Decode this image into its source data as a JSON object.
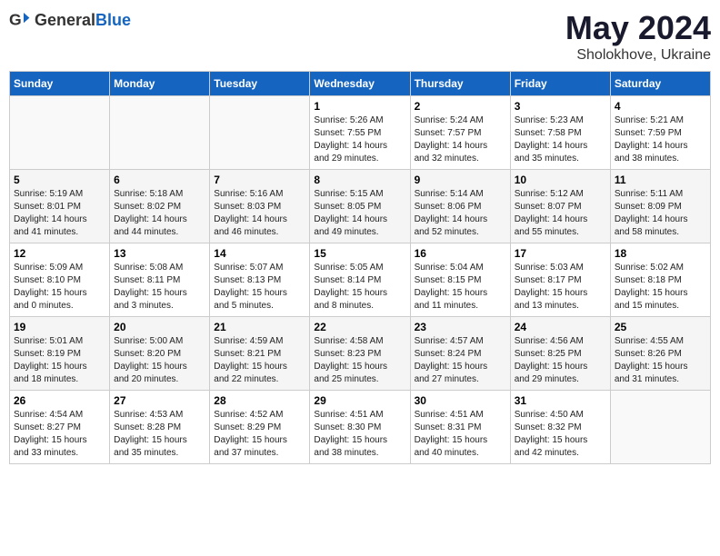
{
  "header": {
    "logo_general": "General",
    "logo_blue": "Blue",
    "month_title": "May 2024",
    "location": "Sholokhove, Ukraine"
  },
  "days_of_week": [
    "Sunday",
    "Monday",
    "Tuesday",
    "Wednesday",
    "Thursday",
    "Friday",
    "Saturday"
  ],
  "weeks": [
    {
      "days": [
        {
          "num": "",
          "text": ""
        },
        {
          "num": "",
          "text": ""
        },
        {
          "num": "",
          "text": ""
        },
        {
          "num": "1",
          "text": "Sunrise: 5:26 AM\nSunset: 7:55 PM\nDaylight: 14 hours\nand 29 minutes."
        },
        {
          "num": "2",
          "text": "Sunrise: 5:24 AM\nSunset: 7:57 PM\nDaylight: 14 hours\nand 32 minutes."
        },
        {
          "num": "3",
          "text": "Sunrise: 5:23 AM\nSunset: 7:58 PM\nDaylight: 14 hours\nand 35 minutes."
        },
        {
          "num": "4",
          "text": "Sunrise: 5:21 AM\nSunset: 7:59 PM\nDaylight: 14 hours\nand 38 minutes."
        }
      ]
    },
    {
      "days": [
        {
          "num": "5",
          "text": "Sunrise: 5:19 AM\nSunset: 8:01 PM\nDaylight: 14 hours\nand 41 minutes."
        },
        {
          "num": "6",
          "text": "Sunrise: 5:18 AM\nSunset: 8:02 PM\nDaylight: 14 hours\nand 44 minutes."
        },
        {
          "num": "7",
          "text": "Sunrise: 5:16 AM\nSunset: 8:03 PM\nDaylight: 14 hours\nand 46 minutes."
        },
        {
          "num": "8",
          "text": "Sunrise: 5:15 AM\nSunset: 8:05 PM\nDaylight: 14 hours\nand 49 minutes."
        },
        {
          "num": "9",
          "text": "Sunrise: 5:14 AM\nSunset: 8:06 PM\nDaylight: 14 hours\nand 52 minutes."
        },
        {
          "num": "10",
          "text": "Sunrise: 5:12 AM\nSunset: 8:07 PM\nDaylight: 14 hours\nand 55 minutes."
        },
        {
          "num": "11",
          "text": "Sunrise: 5:11 AM\nSunset: 8:09 PM\nDaylight: 14 hours\nand 58 minutes."
        }
      ]
    },
    {
      "days": [
        {
          "num": "12",
          "text": "Sunrise: 5:09 AM\nSunset: 8:10 PM\nDaylight: 15 hours\nand 0 minutes."
        },
        {
          "num": "13",
          "text": "Sunrise: 5:08 AM\nSunset: 8:11 PM\nDaylight: 15 hours\nand 3 minutes."
        },
        {
          "num": "14",
          "text": "Sunrise: 5:07 AM\nSunset: 8:13 PM\nDaylight: 15 hours\nand 5 minutes."
        },
        {
          "num": "15",
          "text": "Sunrise: 5:05 AM\nSunset: 8:14 PM\nDaylight: 15 hours\nand 8 minutes."
        },
        {
          "num": "16",
          "text": "Sunrise: 5:04 AM\nSunset: 8:15 PM\nDaylight: 15 hours\nand 11 minutes."
        },
        {
          "num": "17",
          "text": "Sunrise: 5:03 AM\nSunset: 8:17 PM\nDaylight: 15 hours\nand 13 minutes."
        },
        {
          "num": "18",
          "text": "Sunrise: 5:02 AM\nSunset: 8:18 PM\nDaylight: 15 hours\nand 15 minutes."
        }
      ]
    },
    {
      "days": [
        {
          "num": "19",
          "text": "Sunrise: 5:01 AM\nSunset: 8:19 PM\nDaylight: 15 hours\nand 18 minutes."
        },
        {
          "num": "20",
          "text": "Sunrise: 5:00 AM\nSunset: 8:20 PM\nDaylight: 15 hours\nand 20 minutes."
        },
        {
          "num": "21",
          "text": "Sunrise: 4:59 AM\nSunset: 8:21 PM\nDaylight: 15 hours\nand 22 minutes."
        },
        {
          "num": "22",
          "text": "Sunrise: 4:58 AM\nSunset: 8:23 PM\nDaylight: 15 hours\nand 25 minutes."
        },
        {
          "num": "23",
          "text": "Sunrise: 4:57 AM\nSunset: 8:24 PM\nDaylight: 15 hours\nand 27 minutes."
        },
        {
          "num": "24",
          "text": "Sunrise: 4:56 AM\nSunset: 8:25 PM\nDaylight: 15 hours\nand 29 minutes."
        },
        {
          "num": "25",
          "text": "Sunrise: 4:55 AM\nSunset: 8:26 PM\nDaylight: 15 hours\nand 31 minutes."
        }
      ]
    },
    {
      "days": [
        {
          "num": "26",
          "text": "Sunrise: 4:54 AM\nSunset: 8:27 PM\nDaylight: 15 hours\nand 33 minutes."
        },
        {
          "num": "27",
          "text": "Sunrise: 4:53 AM\nSunset: 8:28 PM\nDaylight: 15 hours\nand 35 minutes."
        },
        {
          "num": "28",
          "text": "Sunrise: 4:52 AM\nSunset: 8:29 PM\nDaylight: 15 hours\nand 37 minutes."
        },
        {
          "num": "29",
          "text": "Sunrise: 4:51 AM\nSunset: 8:30 PM\nDaylight: 15 hours\nand 38 minutes."
        },
        {
          "num": "30",
          "text": "Sunrise: 4:51 AM\nSunset: 8:31 PM\nDaylight: 15 hours\nand 40 minutes."
        },
        {
          "num": "31",
          "text": "Sunrise: 4:50 AM\nSunset: 8:32 PM\nDaylight: 15 hours\nand 42 minutes."
        },
        {
          "num": "",
          "text": ""
        }
      ]
    }
  ]
}
